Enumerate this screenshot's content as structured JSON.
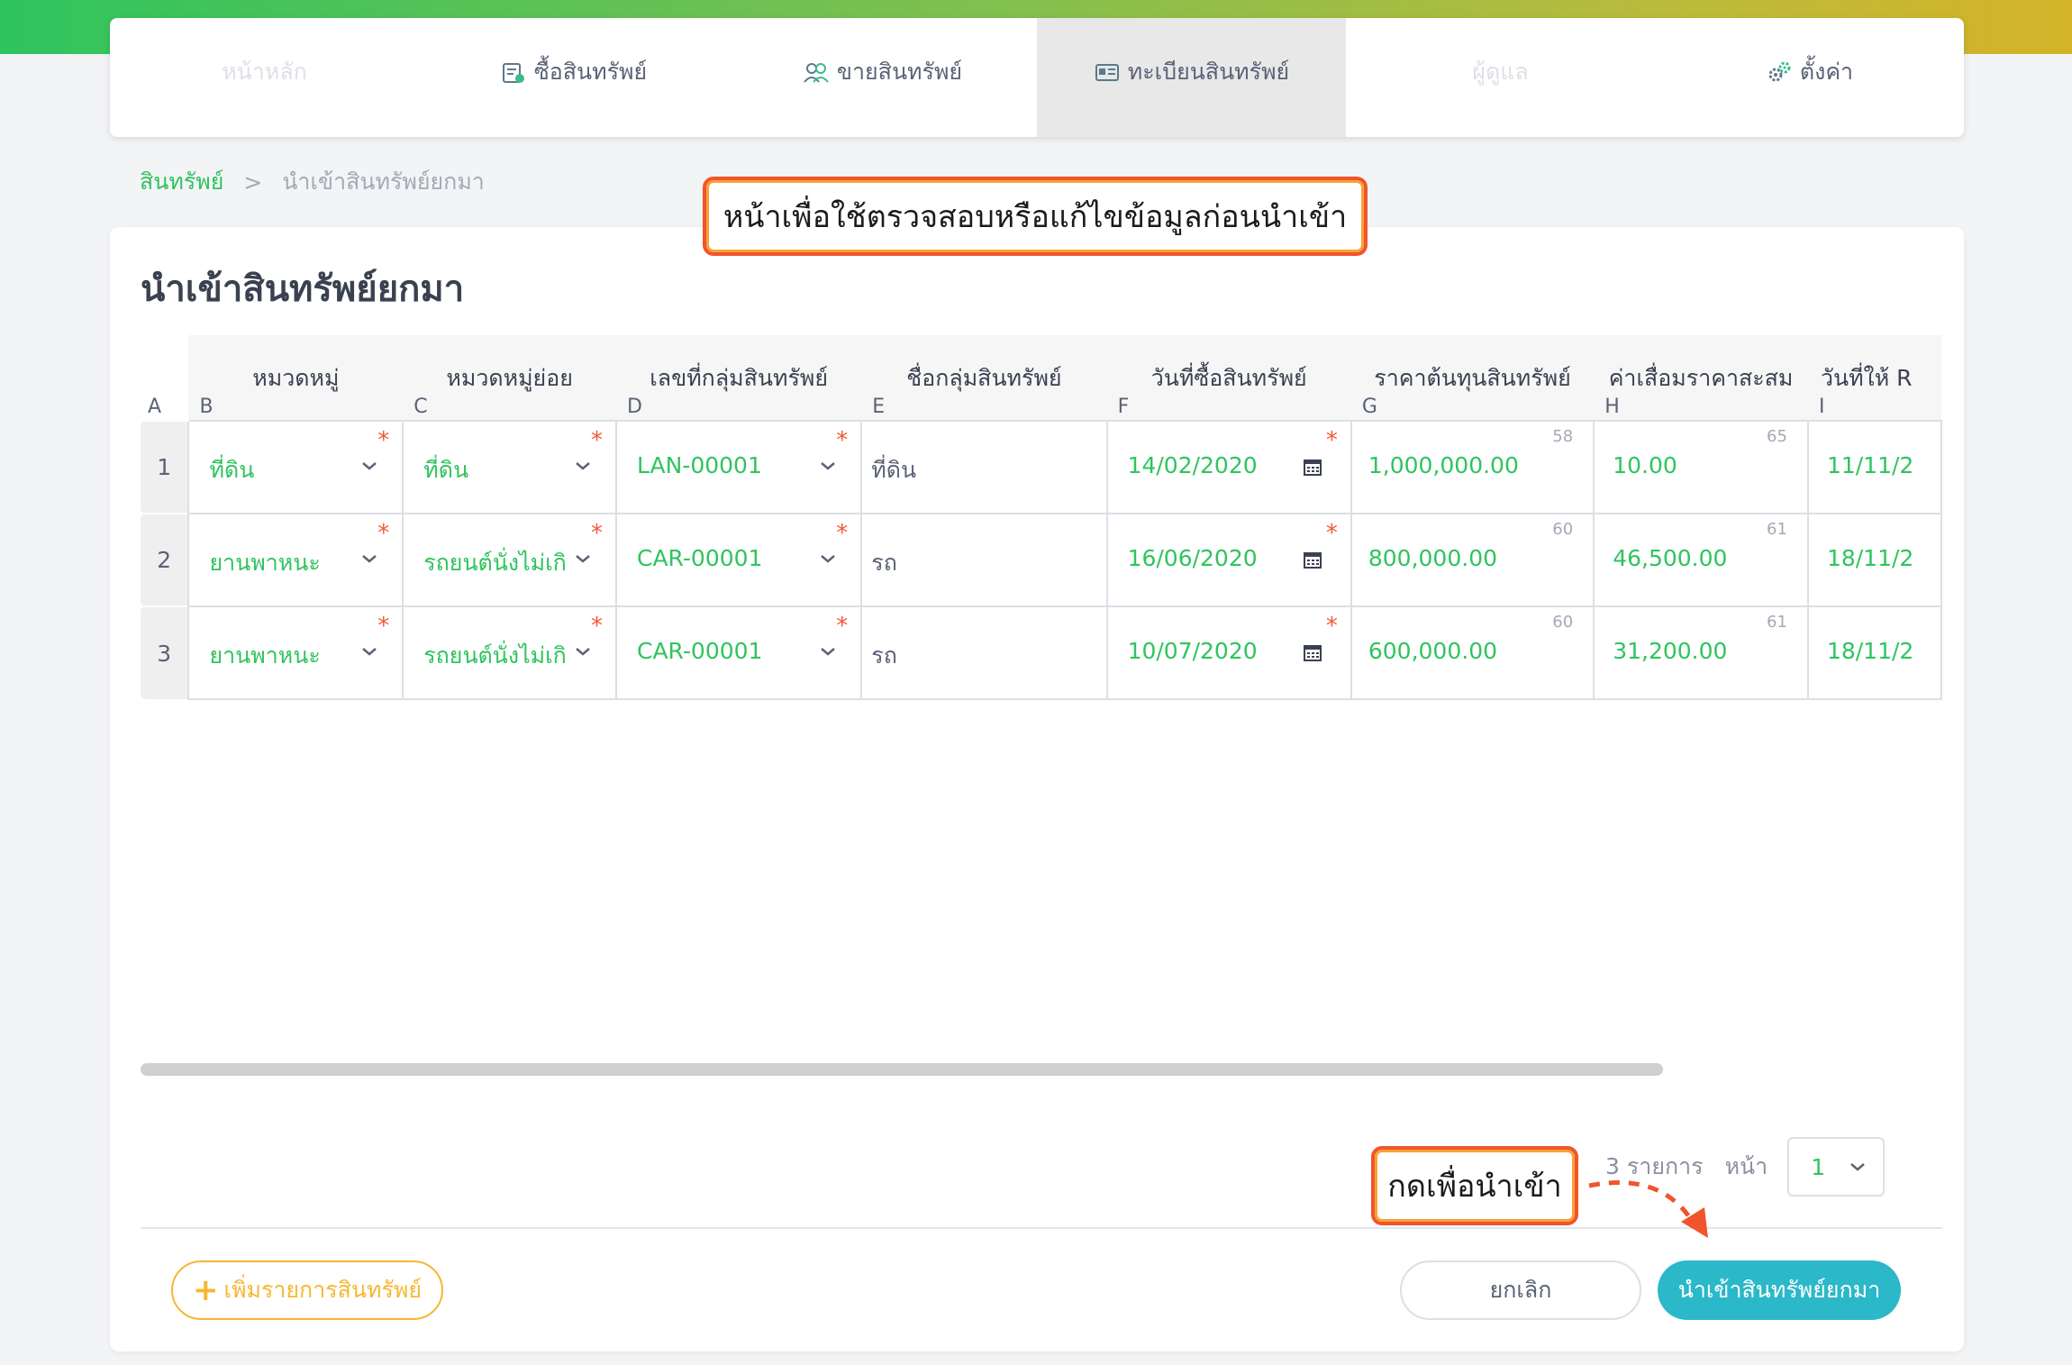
{
  "nav": {
    "items": [
      {
        "label": "หน้าหลัก",
        "icon": "home-icon",
        "state": "dim"
      },
      {
        "label": "ซื้อสินทรัพย์",
        "icon": "purchase-icon",
        "state": "normal"
      },
      {
        "label": "ขายสินทรัพย์",
        "icon": "users-icon",
        "state": "normal"
      },
      {
        "label": "ทะเบียนสินทรัพย์",
        "icon": "id-card-icon",
        "state": "active"
      },
      {
        "label": "ผู้ดูแล",
        "icon": "admin-icon",
        "state": "dim"
      },
      {
        "label": "ตั้งค่า",
        "icon": "gear-icon",
        "state": "normal"
      }
    ]
  },
  "breadcrumb": {
    "root": "สินทรัพย์",
    "separator": ">",
    "current": "นำเข้าสินทรัพย์ยกมา"
  },
  "page": {
    "title": "นำเข้าสินทรัพย์ยกมา"
  },
  "grid": {
    "columns": [
      {
        "letter": "A",
        "title": ""
      },
      {
        "letter": "B",
        "title": "หมวดหมู่"
      },
      {
        "letter": "C",
        "title": "หมวดหมู่ย่อย"
      },
      {
        "letter": "D",
        "title": "เลขที่กลุ่มสินทรัพย์"
      },
      {
        "letter": "E",
        "title": "ชื่อกลุ่มสินทรัพย์"
      },
      {
        "letter": "F",
        "title": "วันที่ซื้อสินทรัพย์"
      },
      {
        "letter": "G",
        "title": "ราคาต้นทุนสินทรัพย์"
      },
      {
        "letter": "H",
        "title": "ค่าเสื่อมราคาสะสม"
      },
      {
        "letter": "I",
        "title": "วันที่ให้ R"
      }
    ],
    "rows": [
      {
        "num": "1",
        "category": "ที่ดิน",
        "subcategory": "ที่ดิน",
        "group_no": "LAN-00001",
        "group_name": "ที่ดิน",
        "purchase_date": "14/02/2020",
        "cost": "1,000,000.00",
        "cost_sup": "58",
        "depreciation": "10.00",
        "dep_sup": "65",
        "start_date": "11/11/2"
      },
      {
        "num": "2",
        "category": "ยานพาหนะ",
        "subcategory": "รถยนต์นั่งไม่เกิ",
        "group_no": "CAR-00001",
        "group_name": "รถ",
        "purchase_date": "16/06/2020",
        "cost": "800,000.00",
        "cost_sup": "60",
        "depreciation": "46,500.00",
        "dep_sup": "61",
        "start_date": "18/11/2"
      },
      {
        "num": "3",
        "category": "ยานพาหนะ",
        "subcategory": "รถยนต์นั่งไม่เกิ",
        "group_no": "CAR-00001",
        "group_name": "รถ",
        "purchase_date": "10/07/2020",
        "cost": "600,000.00",
        "cost_sup": "60",
        "depreciation": "31,200.00",
        "dep_sup": "61",
        "start_date": "18/11/2"
      }
    ],
    "required_mark": "*"
  },
  "pager": {
    "count": "3 รายการ",
    "page_label": "หน้า",
    "page_value": "1"
  },
  "actions": {
    "add_label": "เพิ่มรายการสินทรัพย์",
    "add_plus": "+",
    "cancel_label": "ยกเลิก",
    "import_label": "นำเข้าสินทรัพย์ยกมา"
  },
  "callouts": {
    "top": "หน้าเพื่อใช้ตรวจสอบหรือแก้ไขข้อมูลก่อนนำเข้า",
    "bottom": "กดเพื่อนำเข้า"
  },
  "colors": {
    "accent_green": "#2fc45e",
    "teal_button": "#2bb8c9",
    "orange_outline": "#f7b731",
    "callout_border": "#f0552c",
    "required": "#f35a34"
  }
}
